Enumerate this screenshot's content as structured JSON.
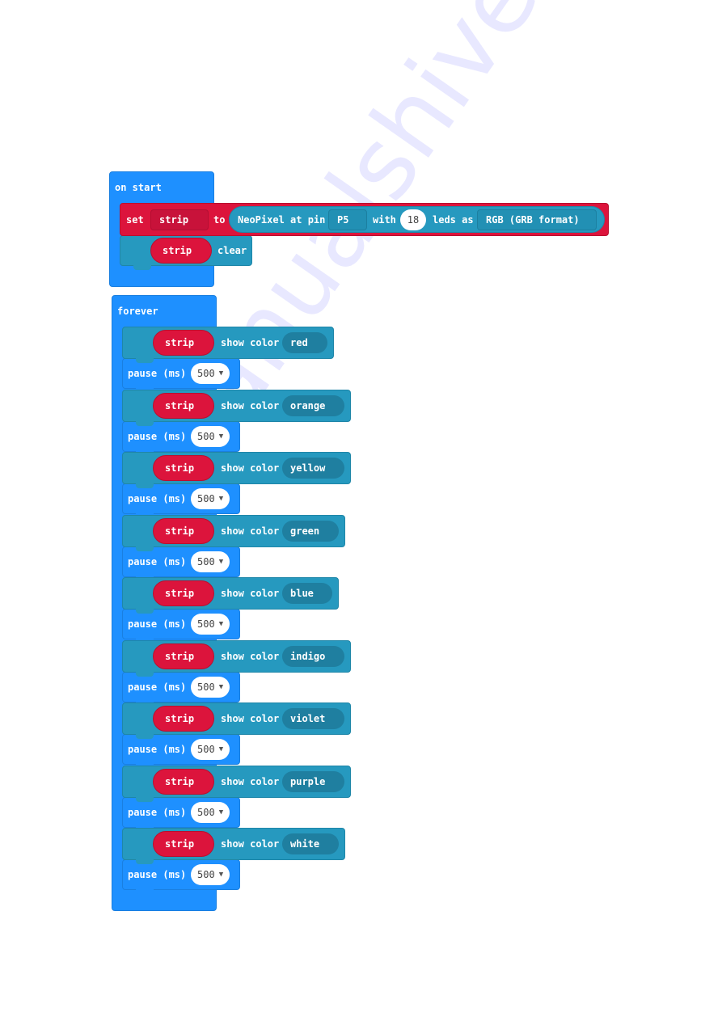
{
  "on_start": {
    "label": "on start",
    "set_block": {
      "set_label": "set",
      "variable": "strip",
      "to_label": "to",
      "neopixel": {
        "label": "NeoPixel at pin",
        "pin": "P5",
        "with_label": "with",
        "led_count": "18",
        "leds_as_label": "leds as",
        "mode": "RGB (GRB format)"
      }
    },
    "clear_block": {
      "variable": "strip",
      "action": "clear"
    }
  },
  "forever": {
    "label": "forever",
    "show_color_label": "show color",
    "pause_label": "pause (ms)",
    "steps": [
      {
        "variable": "strip",
        "color": "red",
        "pause": "500"
      },
      {
        "variable": "strip",
        "color": "orange",
        "pause": "500"
      },
      {
        "variable": "strip",
        "color": "yellow",
        "pause": "500"
      },
      {
        "variable": "strip",
        "color": "green",
        "pause": "500"
      },
      {
        "variable": "strip",
        "color": "blue",
        "pause": "500"
      },
      {
        "variable": "strip",
        "color": "indigo",
        "pause": "500"
      },
      {
        "variable": "strip",
        "color": "violet",
        "pause": "500"
      },
      {
        "variable": "strip",
        "color": "purple",
        "pause": "500"
      },
      {
        "variable": "strip",
        "color": "white",
        "pause": "500"
      }
    ]
  },
  "icons": {
    "dropdown_caret": "▼"
  },
  "colors": {
    "event_blue": "#1E90FF",
    "neopixel_red": "#DC143C",
    "neopixel_teal": "#2699BF"
  },
  "watermark": "manualshive.com"
}
